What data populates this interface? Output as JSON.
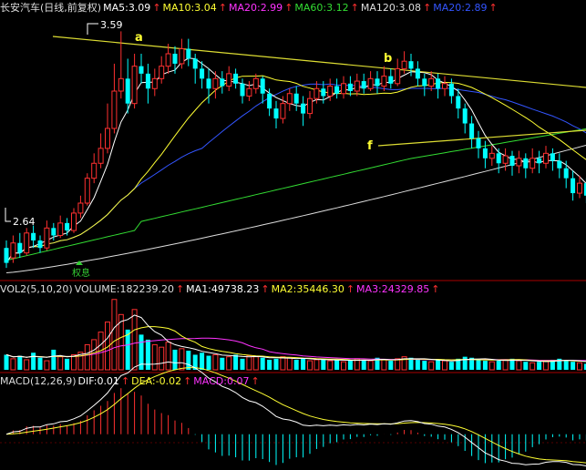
{
  "header": {
    "items": [
      {
        "text": "长安汽车(日线,前复权)",
        "color": "#dddddd",
        "arrow": false
      },
      {
        "text": "MA5:3.09",
        "color": "#ffffff",
        "arrow": true
      },
      {
        "text": "MA10:3.04",
        "color": "#ffff33",
        "arrow": true
      },
      {
        "text": "MA20:2.99",
        "color": "#ff33ff",
        "arrow": true
      },
      {
        "text": "MA60:3.12",
        "color": "#33dd33",
        "arrow": true
      },
      {
        "text": "MA120:3.08",
        "color": "#dddddd",
        "arrow": true
      },
      {
        "text": "MA20:2.89",
        "color": "#3355ff",
        "arrow": true
      }
    ]
  },
  "volume_header": {
    "items": [
      {
        "text": "VOL2(5,10,20)",
        "color": "#dddddd",
        "arrow": false
      },
      {
        "text": "VOLUME:182239.20",
        "color": "#dddddd",
        "arrow": true
      },
      {
        "text": "MA1:49738.23",
        "color": "#ffffff",
        "arrow": true
      },
      {
        "text": "MA2:35446.30",
        "color": "#ffff33",
        "arrow": true
      },
      {
        "text": "MA3:24329.85",
        "color": "#ff33ff",
        "arrow": true
      }
    ]
  },
  "macd_header": {
    "items": [
      {
        "text": "MACD(12,26,9)",
        "color": "#dddddd",
        "arrow": false
      },
      {
        "text": "DIF:0.01",
        "color": "#ffffff",
        "arrow": true
      },
      {
        "text": "DEA:-0.02",
        "color": "#ffff33",
        "arrow": true
      },
      {
        "text": "MACD:0.07",
        "color": "#ff33ff",
        "arrow": true
      }
    ]
  },
  "annotations": {
    "high_label": "3.59",
    "low_label": "2.64",
    "a": "a",
    "b": "b",
    "f": "f",
    "event_label": "权息"
  },
  "colors": {
    "up": "#ff3030",
    "down": "#00ffff",
    "trend": "#dddd33",
    "grid": "#aa0000"
  },
  "chart_data": {
    "type": "candlestick",
    "price_range": [
      2.6,
      3.65
    ],
    "candles": [
      [
        2.72,
        2.66,
        2.75,
        2.64
      ],
      [
        2.68,
        2.74,
        2.77,
        2.66
      ],
      [
        2.74,
        2.7,
        2.78,
        2.68
      ],
      [
        2.7,
        2.78,
        2.8,
        2.69
      ],
      [
        2.78,
        2.75,
        2.81,
        2.72
      ],
      [
        2.75,
        2.72,
        2.77,
        2.7
      ],
      [
        2.72,
        2.8,
        2.83,
        2.71
      ],
      [
        2.8,
        2.77,
        2.82,
        2.75
      ],
      [
        2.77,
        2.82,
        2.85,
        2.76
      ],
      [
        2.82,
        2.79,
        2.84,
        2.77
      ],
      [
        2.79,
        2.86,
        2.88,
        2.78
      ],
      [
        2.86,
        2.9,
        2.93,
        2.84
      ],
      [
        2.9,
        3.0,
        3.02,
        2.89
      ],
      [
        3.0,
        3.06,
        3.1,
        2.98
      ],
      [
        3.06,
        3.12,
        3.18,
        3.04
      ],
      [
        3.12,
        3.2,
        3.3,
        3.1
      ],
      [
        3.2,
        3.35,
        3.46,
        3.18
      ],
      [
        3.35,
        3.4,
        3.59,
        3.32
      ],
      [
        3.4,
        3.3,
        3.48,
        3.26
      ],
      [
        3.3,
        3.45,
        3.5,
        3.28
      ],
      [
        3.45,
        3.42,
        3.5,
        3.38
      ],
      [
        3.42,
        3.36,
        3.46,
        3.3
      ],
      [
        3.36,
        3.4,
        3.44,
        3.33
      ],
      [
        3.4,
        3.45,
        3.49,
        3.38
      ],
      [
        3.45,
        3.5,
        3.54,
        3.42
      ],
      [
        3.5,
        3.46,
        3.53,
        3.42
      ],
      [
        3.46,
        3.52,
        3.56,
        3.44
      ],
      [
        3.52,
        3.48,
        3.56,
        3.45
      ],
      [
        3.48,
        3.44,
        3.5,
        3.38
      ],
      [
        3.44,
        3.4,
        3.47,
        3.36
      ],
      [
        3.4,
        3.36,
        3.44,
        3.3
      ],
      [
        3.36,
        3.4,
        3.43,
        3.32
      ],
      [
        3.4,
        3.37,
        3.43,
        3.34
      ],
      [
        3.37,
        3.42,
        3.45,
        3.35
      ],
      [
        3.42,
        3.38,
        3.44,
        3.36
      ],
      [
        3.38,
        3.33,
        3.4,
        3.3
      ],
      [
        3.33,
        3.36,
        3.39,
        3.31
      ],
      [
        3.36,
        3.4,
        3.42,
        3.34
      ],
      [
        3.4,
        3.34,
        3.41,
        3.3
      ],
      [
        3.34,
        3.28,
        3.36,
        3.25
      ],
      [
        3.28,
        3.24,
        3.31,
        3.2
      ],
      [
        3.24,
        3.3,
        3.33,
        3.22
      ],
      [
        3.3,
        3.34,
        3.36,
        3.27
      ],
      [
        3.34,
        3.3,
        3.37,
        3.27
      ],
      [
        3.3,
        3.26,
        3.33,
        3.21
      ],
      [
        3.26,
        3.32,
        3.35,
        3.24
      ],
      [
        3.32,
        3.36,
        3.39,
        3.3
      ],
      [
        3.36,
        3.33,
        3.39,
        3.3
      ],
      [
        3.33,
        3.37,
        3.4,
        3.31
      ],
      [
        3.37,
        3.34,
        3.4,
        3.32
      ],
      [
        3.34,
        3.38,
        3.41,
        3.32
      ],
      [
        3.38,
        3.35,
        3.41,
        3.33
      ],
      [
        3.35,
        3.39,
        3.42,
        3.33
      ],
      [
        3.39,
        3.36,
        3.42,
        3.34
      ],
      [
        3.36,
        3.4,
        3.43,
        3.35
      ],
      [
        3.4,
        3.37,
        3.43,
        3.34
      ],
      [
        3.37,
        3.41,
        3.45,
        3.35
      ],
      [
        3.41,
        3.38,
        3.44,
        3.36
      ],
      [
        3.38,
        3.44,
        3.48,
        3.37
      ],
      [
        3.44,
        3.47,
        3.51,
        3.42
      ],
      [
        3.47,
        3.44,
        3.5,
        3.41
      ],
      [
        3.44,
        3.4,
        3.47,
        3.37
      ],
      [
        3.4,
        3.37,
        3.42,
        3.33
      ],
      [
        3.37,
        3.4,
        3.43,
        3.35
      ],
      [
        3.4,
        3.36,
        3.42,
        3.32
      ],
      [
        3.36,
        3.38,
        3.41,
        3.33
      ],
      [
        3.38,
        3.33,
        3.4,
        3.3
      ],
      [
        3.33,
        3.28,
        3.36,
        3.24
      ],
      [
        3.28,
        3.22,
        3.3,
        3.18
      ],
      [
        3.22,
        3.16,
        3.25,
        3.12
      ],
      [
        3.16,
        3.12,
        3.19,
        3.08
      ],
      [
        3.12,
        3.08,
        3.15,
        3.04
      ],
      [
        3.08,
        3.1,
        3.13,
        3.05
      ],
      [
        3.1,
        3.06,
        3.12,
        3.02
      ],
      [
        3.06,
        3.09,
        3.12,
        3.03
      ],
      [
        3.09,
        3.05,
        3.11,
        3.01
      ],
      [
        3.05,
        3.08,
        3.11,
        3.02
      ],
      [
        3.08,
        3.04,
        3.1,
        3.0
      ],
      [
        3.04,
        3.08,
        3.12,
        3.02
      ],
      [
        3.08,
        3.06,
        3.11,
        3.02
      ],
      [
        3.06,
        3.1,
        3.13,
        3.04
      ],
      [
        3.1,
        3.07,
        3.12,
        3.03
      ],
      [
        3.07,
        3.04,
        3.1,
        3.0
      ],
      [
        3.04,
        3.0,
        3.07,
        2.96
      ],
      [
        3.0,
        2.94,
        3.03,
        2.91
      ],
      [
        2.94,
        2.98,
        3.01,
        2.92
      ],
      [
        2.98,
        2.93,
        3.0,
        2.9
      ]
    ],
    "volume": [
      30,
      22,
      28,
      20,
      34,
      24,
      18,
      40,
      26,
      22,
      30,
      35,
      50,
      60,
      75,
      95,
      140,
      110,
      80,
      120,
      70,
      60,
      50,
      45,
      55,
      40,
      42,
      38,
      30,
      34,
      28,
      30,
      24,
      26,
      30,
      22,
      28,
      26,
      24,
      20,
      22,
      26,
      24,
      20,
      22,
      18,
      20,
      22,
      18,
      20,
      16,
      18,
      22,
      20,
      18,
      24,
      20,
      18,
      22,
      26,
      24,
      20,
      18,
      16,
      20,
      18,
      16,
      22,
      26,
      24,
      20,
      18,
      16,
      18,
      20,
      22,
      18,
      16,
      14,
      16,
      18,
      20,
      22,
      18,
      16,
      14,
      12
    ],
    "volume_range": [
      0,
      145
    ],
    "macd_range": [
      -0.09,
      0.12
    ]
  }
}
